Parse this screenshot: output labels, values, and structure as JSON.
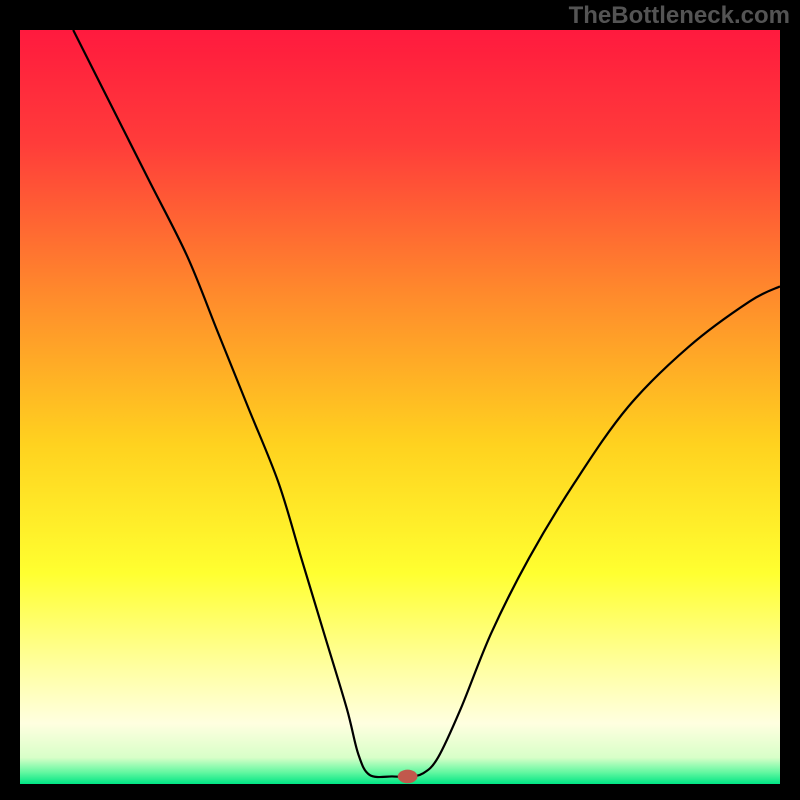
{
  "watermark": "TheBottleneck.com",
  "chart_data": {
    "type": "line",
    "title": "",
    "xlabel": "",
    "ylabel": "",
    "xlim": [
      0,
      100
    ],
    "ylim": [
      0,
      100
    ],
    "grid": false,
    "legend": false,
    "background_gradient": {
      "stops": [
        {
          "offset": 0.0,
          "color": "#ff1a3e"
        },
        {
          "offset": 0.15,
          "color": "#ff3c3a"
        },
        {
          "offset": 0.35,
          "color": "#ff8a2c"
        },
        {
          "offset": 0.55,
          "color": "#ffd21f"
        },
        {
          "offset": 0.72,
          "color": "#ffff30"
        },
        {
          "offset": 0.85,
          "color": "#ffffa5"
        },
        {
          "offset": 0.92,
          "color": "#ffffe0"
        },
        {
          "offset": 0.965,
          "color": "#d8ffc8"
        },
        {
          "offset": 0.985,
          "color": "#60f7a0"
        },
        {
          "offset": 1.0,
          "color": "#00e584"
        }
      ]
    },
    "series": [
      {
        "name": "bottleneck-curve",
        "color": "#000000",
        "stroke_width": 2.2,
        "points": [
          {
            "x": 7,
            "y": 100
          },
          {
            "x": 12,
            "y": 90
          },
          {
            "x": 17,
            "y": 80
          },
          {
            "x": 22,
            "y": 70
          },
          {
            "x": 26,
            "y": 60
          },
          {
            "x": 30,
            "y": 50
          },
          {
            "x": 34,
            "y": 40
          },
          {
            "x": 37,
            "y": 30
          },
          {
            "x": 40,
            "y": 20
          },
          {
            "x": 43,
            "y": 10
          },
          {
            "x": 44.5,
            "y": 4
          },
          {
            "x": 46,
            "y": 1.2
          },
          {
            "x": 49,
            "y": 1.0
          },
          {
            "x": 51,
            "y": 1.0
          },
          {
            "x": 53,
            "y": 1.4
          },
          {
            "x": 55,
            "y": 3.5
          },
          {
            "x": 58,
            "y": 10
          },
          {
            "x": 62,
            "y": 20
          },
          {
            "x": 67,
            "y": 30
          },
          {
            "x": 73,
            "y": 40
          },
          {
            "x": 80,
            "y": 50
          },
          {
            "x": 88,
            "y": 58
          },
          {
            "x": 96,
            "y": 64
          },
          {
            "x": 100,
            "y": 66
          }
        ]
      }
    ],
    "marker": {
      "name": "optimal-point",
      "x": 51,
      "y": 1.0,
      "color": "#c1584c",
      "rx": 1.3,
      "ry": 0.9
    }
  }
}
